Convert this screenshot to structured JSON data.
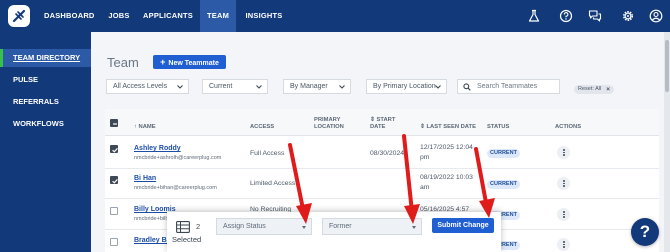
{
  "topnav": {
    "items": [
      {
        "label": "DASHBOARD"
      },
      {
        "label": "JOBS"
      },
      {
        "label": "APPLICANTS"
      },
      {
        "label": "TEAM"
      },
      {
        "label": "INSIGHTS"
      }
    ],
    "active": "TEAM",
    "icons": [
      "flask-icon",
      "help-circle-icon",
      "chat-icon",
      "gear-icon",
      "user-circle-icon"
    ]
  },
  "sidebar": {
    "items": [
      {
        "label": "TEAM DIRECTORY"
      },
      {
        "label": "PULSE"
      },
      {
        "label": "REFERRALS"
      },
      {
        "label": "WORKFLOWS"
      }
    ],
    "active": "TEAM DIRECTORY"
  },
  "page": {
    "title": "Team",
    "new_button": "New Teammate"
  },
  "filters": {
    "access_levels": "All Access Levels",
    "status": "Current",
    "manager": "By Manager",
    "location": "By Primary Location",
    "search_placeholder": "Search Teammates",
    "reset_label": "Reset: All"
  },
  "table": {
    "headers": {
      "name": "NAME",
      "access": "ACCESS",
      "primary_location_1": "PRIMARY",
      "primary_location_2": "LOCATION",
      "start_date_1": "START",
      "start_date_2": "DATE",
      "last_seen": "LAST SEEN DATE",
      "status": "STATUS",
      "actions": "ACTIONS"
    },
    "rows": [
      {
        "name": "Ashley Roddy",
        "email": "nmcbride+ashrolh@careerplug.com",
        "access": "Full Access",
        "start_date": "08/30/2024",
        "last_seen_1": "12/17/2025 12:04",
        "last_seen_2": "pm",
        "status": "CURRENT",
        "checked": true
      },
      {
        "name": "Bi Han",
        "email": "nmcbride+bihan@careerplug.com",
        "access": "Limited Access",
        "start_date": "",
        "last_seen_1": "08/19/2022 10:03",
        "last_seen_2": "am",
        "status": "CURRENT",
        "checked": true
      },
      {
        "name": "Billy Loomis",
        "email": "nmcbride+billy",
        "access": "No Recruiting",
        "start_date": "",
        "last_seen_1": "05/16/2025 4:57",
        "last_seen_2": "",
        "status": "CURRENT",
        "checked": false
      },
      {
        "name": "Bradley Brown",
        "email": "",
        "access": "",
        "start_date": "",
        "last_seen_1": "",
        "last_seen_2": "",
        "status": "CURRENT",
        "checked": false
      }
    ]
  },
  "bulk": {
    "count": "2",
    "selected_label": "Selected",
    "action_select": "Assign Status",
    "value_select": "Former",
    "submit_label": "Submit Change"
  },
  "help_button": "?",
  "colors": {
    "nav_bg": "#123a7a",
    "nav_active": "#2c5aa6",
    "sidebar_indicator": "#35c24a",
    "primary_button": "#1f5fd1",
    "annotation_arrow": "#e01b1b",
    "badge_bg": "#dde9fb"
  }
}
